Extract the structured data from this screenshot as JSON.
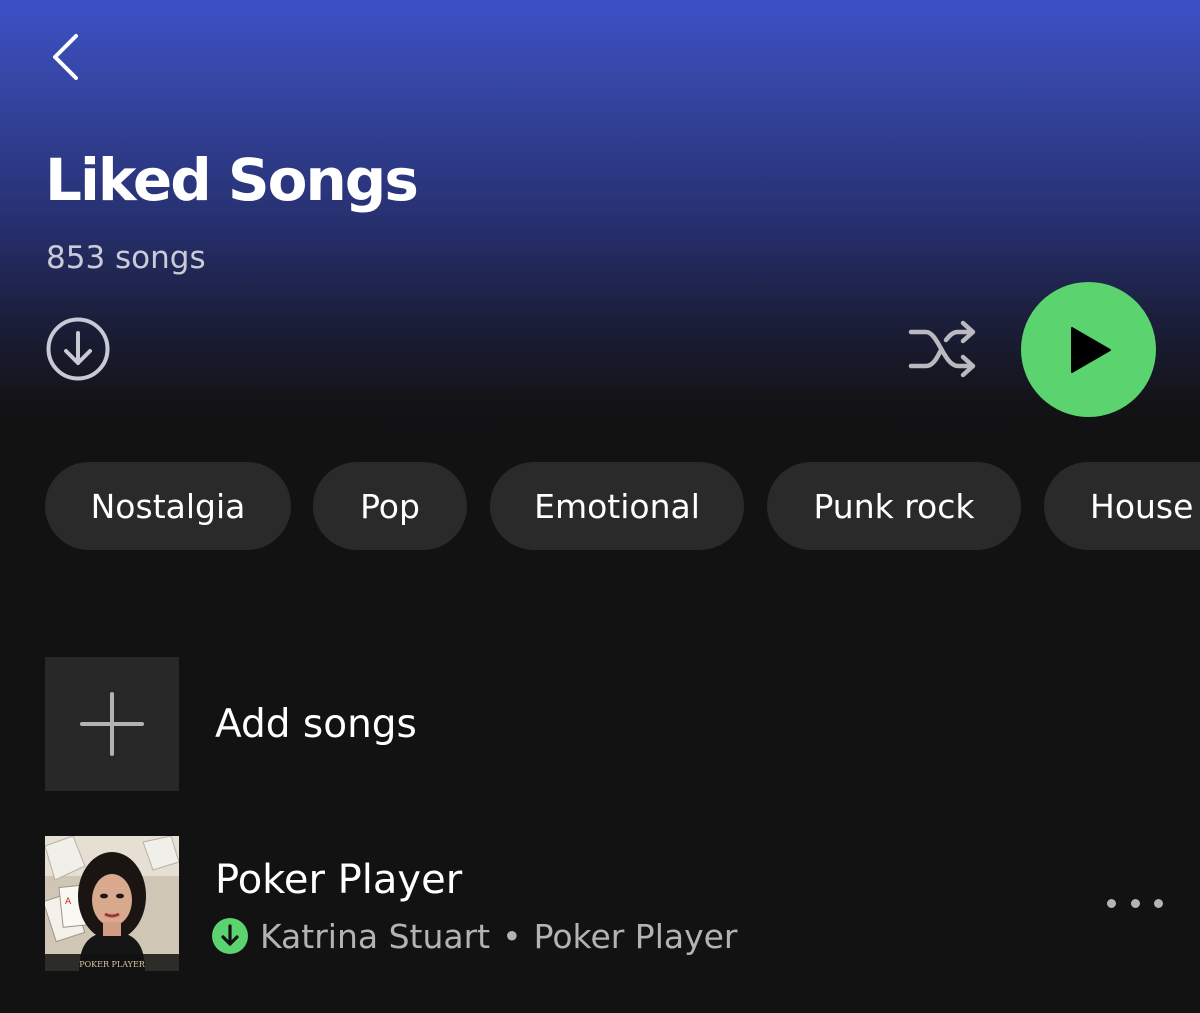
{
  "header": {
    "back_icon": "chevron-left-icon",
    "title": "Liked Songs",
    "song_count": "853 songs"
  },
  "controls": {
    "download_icon": "download-circle-icon",
    "shuffle_icon": "shuffle-icon",
    "play_icon": "play-icon",
    "play_button_color": "#5bd46f"
  },
  "filters": [
    {
      "label": "Nostalgia"
    },
    {
      "label": "Pop"
    },
    {
      "label": "Emotional"
    },
    {
      "label": "Punk rock"
    },
    {
      "label": "House"
    }
  ],
  "add_songs": {
    "icon": "plus-icon",
    "label": "Add songs"
  },
  "tracks": [
    {
      "title": "Poker Player",
      "artist": "Katrina Stuart",
      "separator": "•",
      "album": "Poker Player",
      "downloaded_icon": "downloaded-icon",
      "more_icon": "more-options-icon",
      "cover_text": "POKER PLAYER"
    }
  ],
  "colors": {
    "background": "#121212",
    "header_gradient_top": "#3c51c6",
    "accent_green": "#5bd46f",
    "chip_background": "#2a2a2a",
    "secondary_text": "#b3b3b3"
  }
}
